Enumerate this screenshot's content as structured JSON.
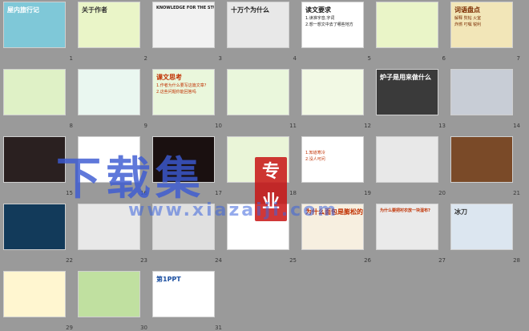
{
  "watermark": {
    "main": "下载集",
    "badge_top": "专",
    "badge_bottom": "业",
    "url": "www.xiazaiji.com"
  },
  "slides": [
    {
      "num": "1",
      "tag": "",
      "bg": "#7fc8d8",
      "title": "屋内旅行记",
      "title_color": "#ffffff",
      "lines": []
    },
    {
      "num": "2",
      "tag": "",
      "bg": "#eaf5c8",
      "title": "关于作者",
      "title_color": "#333333",
      "lines": []
    },
    {
      "num": "3",
      "tag": "",
      "bg": "#f2f2f2",
      "title": "KNOWLEDGE FOR THE STUDENTS",
      "title_color": "#1a1a1a",
      "lines": []
    },
    {
      "num": "4",
      "tag": "",
      "bg": "#e8e8e8",
      "title": "十万个为什么",
      "title_color": "#222222",
      "lines": []
    },
    {
      "num": "5",
      "tag": "",
      "bg": "#ffffff",
      "title": "读文要求",
      "title_color": "#1a1a1a",
      "lines": [
        "1.读准字音,字词",
        "2.想一想文中去了哪些地方"
      ]
    },
    {
      "num": "6",
      "tag": "",
      "bg": "#eaf5c8",
      "title": "",
      "title_color": "#333333",
      "lines": []
    },
    {
      "num": "7",
      "tag": "",
      "bg": "#f2e6b8",
      "title": "词语盘点",
      "title_color": "#7a2b00",
      "lines": [
        "解释 熨帖 火室",
        "炸燃 叮嘱 锐利"
      ]
    },
    {
      "num": "8",
      "tag": "",
      "bg": "#dff1c6",
      "title": "",
      "title_color": "#c03000",
      "lines": []
    },
    {
      "num": "9",
      "tag": "",
      "bg": "#eaf7f0",
      "title": "",
      "title_color": "#c03000",
      "lines": []
    },
    {
      "num": "10",
      "tag": "",
      "bg": "#eaf7dc",
      "title": "课文思考",
      "title_color": "#c03000",
      "lines": [
        "1.作者为什么要写这篇文章?",
        "2.这些问题你能回答吗"
      ]
    },
    {
      "num": "11",
      "tag": "",
      "bg": "#eaf7dc",
      "title": "",
      "title_color": "#c03000",
      "lines": []
    },
    {
      "num": "12",
      "tag": "",
      "bg": "#f2f9e4",
      "title": "",
      "title_color": "#c03000",
      "lines": []
    },
    {
      "num": "13",
      "tag": "",
      "bg": "#3a3a3a",
      "title": "炉子是用来做什么",
      "title_color": "#ffffff",
      "lines": []
    },
    {
      "num": "14",
      "tag": "",
      "bg": "#c8cdd6",
      "title": "",
      "title_color": "#ffffff",
      "lines": []
    },
    {
      "num": "15",
      "tag": "",
      "bg": "#2a2020",
      "title": "",
      "title_color": "#ffffff",
      "lines": []
    },
    {
      "num": "16",
      "tag": "",
      "bg": "#ffffff",
      "title": "",
      "title_color": "#333333",
      "lines": []
    },
    {
      "num": "17",
      "tag": "",
      "bg": "#1a1010",
      "title": "",
      "title_color": "#ffffff",
      "lines": []
    },
    {
      "num": "18",
      "tag": "",
      "bg": "#eaf5d8",
      "title": "",
      "title_color": "#c03000",
      "lines": []
    },
    {
      "num": "19",
      "tag": "",
      "bg": "#ffffff",
      "title": "",
      "title_color": "#c03000",
      "lines": [
        "1.知道寒冷",
        "2.没人可问"
      ]
    },
    {
      "num": "20",
      "tag": "",
      "bg": "#e8e8e8",
      "title": "",
      "title_color": "#333333",
      "lines": []
    },
    {
      "num": "21",
      "tag": "",
      "bg": "#7a4a28",
      "title": "",
      "title_color": "#ffffff",
      "lines": []
    },
    {
      "num": "22",
      "tag": "",
      "bg": "#123a5a",
      "title": "",
      "title_color": "#ffffff",
      "lines": []
    },
    {
      "num": "23",
      "tag": "",
      "bg": "#e8e8e8",
      "title": "",
      "title_color": "#333333",
      "lines": []
    },
    {
      "num": "24",
      "tag": "",
      "bg": "#e0e0e0",
      "title": "",
      "title_color": "#333333",
      "lines": []
    },
    {
      "num": "25",
      "tag": "",
      "bg": "#ffffff",
      "title": "",
      "title_color": "#333333",
      "lines": []
    },
    {
      "num": "26",
      "tag": "",
      "bg": "#f7efe0",
      "title": "为什么面包是膨松的?",
      "title_color": "#c03000",
      "lines": []
    },
    {
      "num": "27",
      "tag": "",
      "bg": "#eaeaea",
      "title": "为什么要把衬衣放一块湿布?",
      "title_color": "#c03000",
      "lines": []
    },
    {
      "num": "28",
      "tag": "",
      "bg": "#dce6f0",
      "title": "冰刀",
      "title_color": "#333333",
      "lines": []
    },
    {
      "num": "29",
      "tag": "",
      "bg": "#fff6d0",
      "title": "",
      "title_color": "#c03000",
      "lines": []
    },
    {
      "num": "30",
      "tag": "",
      "bg": "#c0e0a0",
      "title": "",
      "title_color": "#333333",
      "lines": []
    },
    {
      "num": "31",
      "tag": "",
      "bg": "#ffffff",
      "title": "第1PPT",
      "title_color": "#1a4ea0",
      "lines": []
    }
  ],
  "colors": {
    "canvas": "#9a9a9a",
    "accent_red": "#c03000",
    "watermark_blue": "#3c5ad2"
  }
}
